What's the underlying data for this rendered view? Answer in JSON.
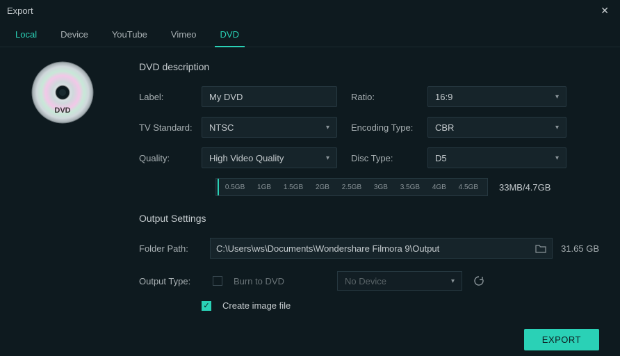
{
  "window": {
    "title": "Export"
  },
  "tabs": {
    "local": "Local",
    "device": "Device",
    "youtube": "YouTube",
    "vimeo": "Vimeo",
    "dvd": "DVD"
  },
  "dvd": {
    "section_title": "DVD description",
    "label_lbl": "Label:",
    "label_val": "My DVD",
    "ratio_lbl": "Ratio:",
    "ratio_val": "16:9",
    "tvstd_lbl": "TV Standard:",
    "tvstd_val": "NTSC",
    "enc_lbl": "Encoding Type:",
    "enc_val": "CBR",
    "quality_lbl": "Quality:",
    "quality_val": "High Video Quality",
    "disc_lbl": "Disc Type:",
    "disc_val": "D5",
    "ticks": [
      "0.5GB",
      "1GB",
      "1.5GB",
      "2GB",
      "2.5GB",
      "3GB",
      "3.5GB",
      "4GB",
      "4.5GB"
    ],
    "size_text": "33MB/4.7GB"
  },
  "output": {
    "section_title": "Output Settings",
    "folder_lbl": "Folder Path:",
    "folder_val": "C:\\Users\\ws\\Documents\\Wondershare Filmora 9\\Output",
    "free_space": "31.65 GB",
    "type_lbl": "Output Type:",
    "burn_lbl": "Burn to DVD",
    "device_val": "No Device",
    "image_lbl": "Create image file"
  },
  "footer": {
    "export": "EXPORT"
  },
  "disc_label": "DVD"
}
